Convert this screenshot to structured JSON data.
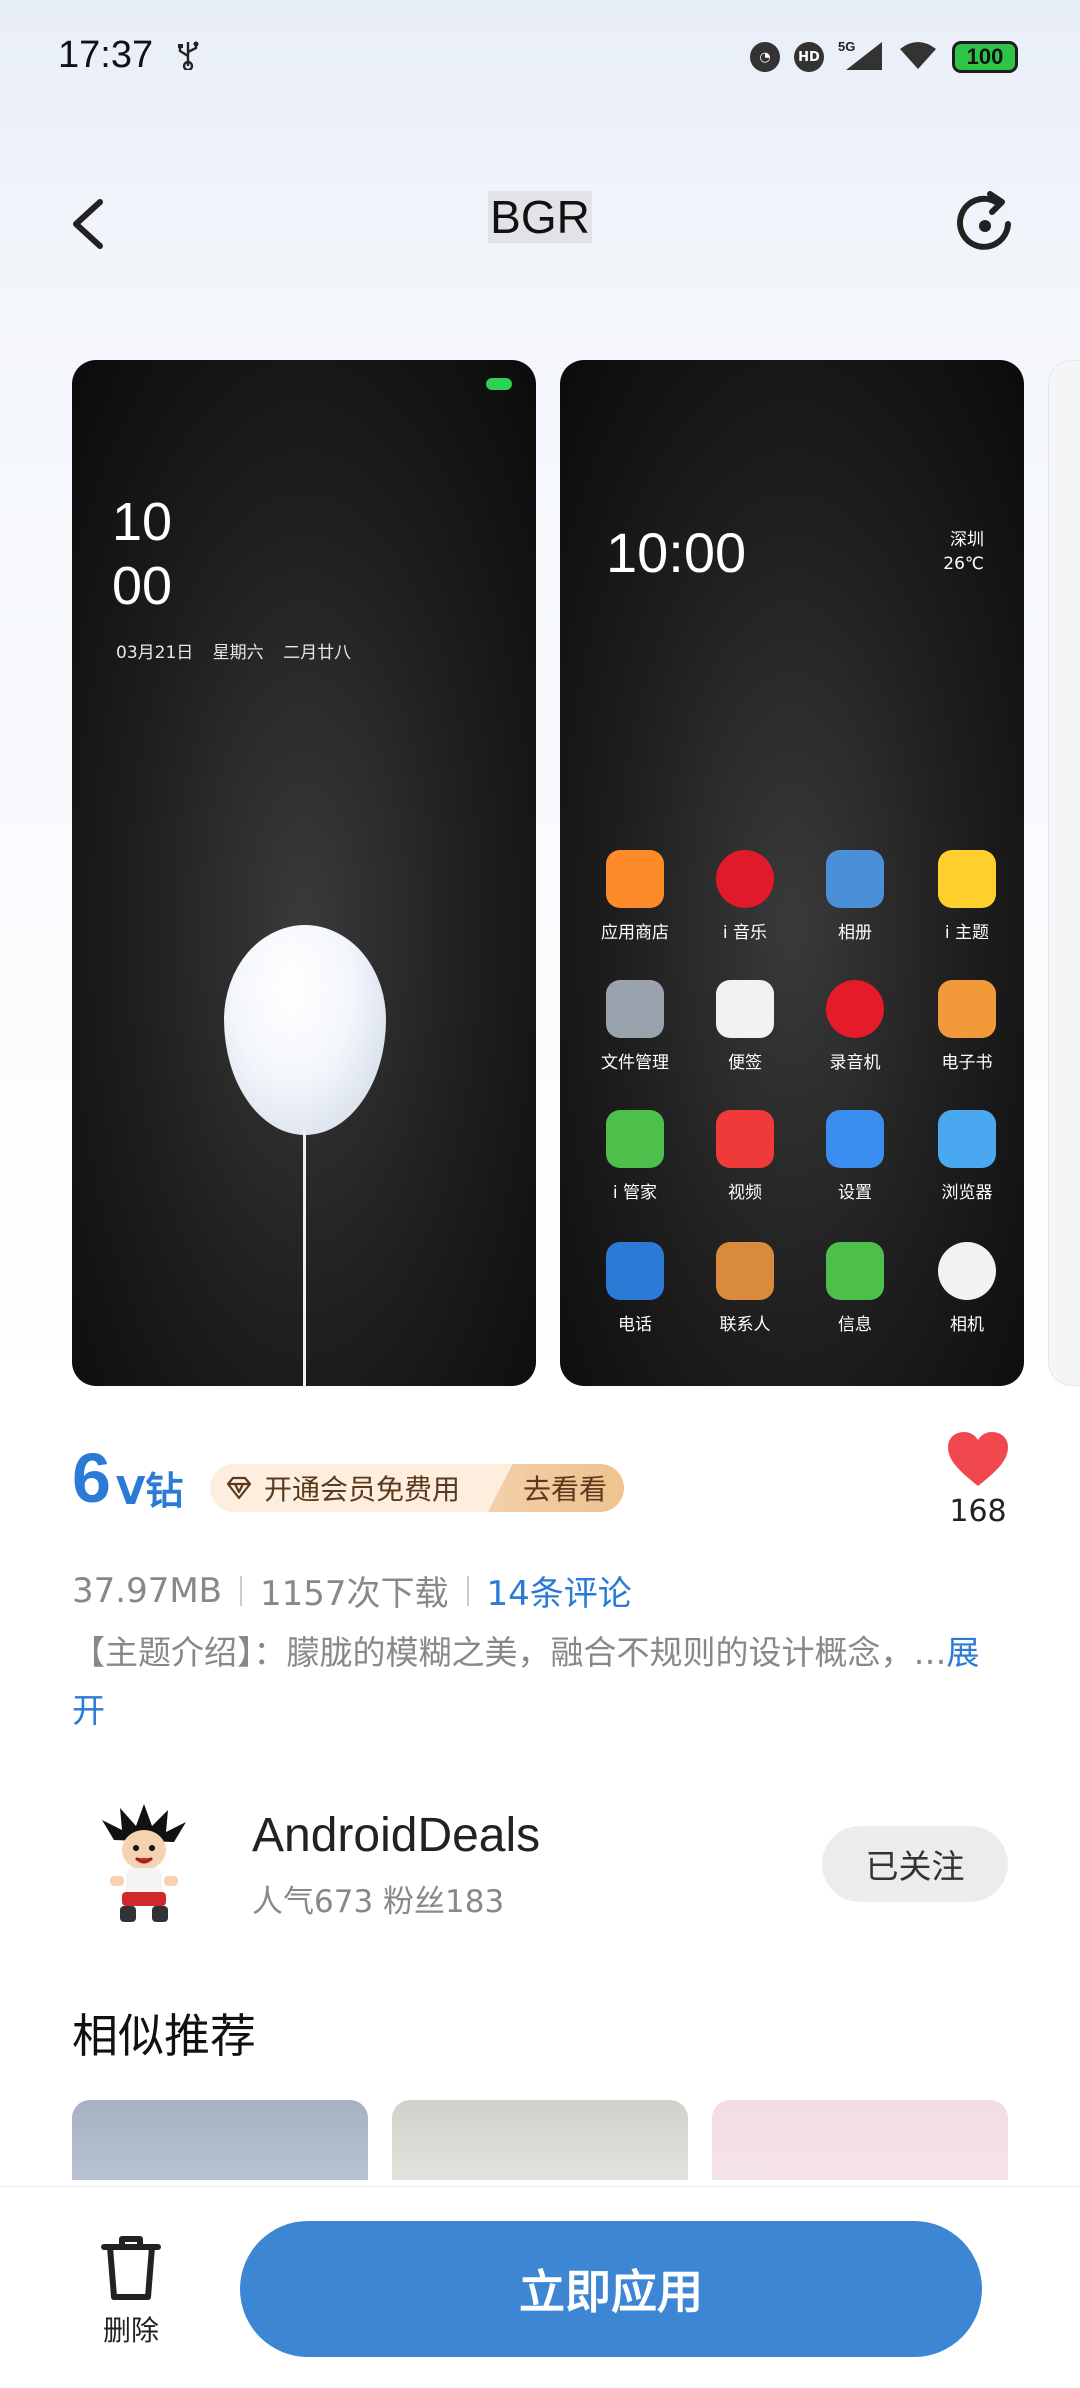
{
  "status_bar": {
    "time": "17:37",
    "icons": [
      "usb-icon",
      "nfc-icon",
      "hd-icon",
      "5g-signal-icon",
      "wifi-icon"
    ],
    "network": "5G",
    "hd": "HD",
    "battery": "100",
    "battery_color": "#2ec44a"
  },
  "header": {
    "title": "BGR",
    "back_icon": "chevron-left-icon",
    "refresh_icon": "refresh-icon"
  },
  "previews": {
    "lock": {
      "time_hours": "10",
      "time_minutes": "00",
      "date": "03月21日  星期六  二月廿八"
    },
    "home": {
      "time": "10:00",
      "city": "深圳",
      "temp": "26℃",
      "apps": [
        {
          "label": "应用商店",
          "color": "#ff8a2a"
        },
        {
          "label": "i 音乐",
          "color": "#e01a2a"
        },
        {
          "label": "相册",
          "color": "#4a90d9"
        },
        {
          "label": "i 主题",
          "color": "#ffcf2e"
        },
        {
          "label": "文件管理",
          "color": "#9aa3ad"
        },
        {
          "label": "便签",
          "color": "#f2f2f2"
        },
        {
          "label": "录音机",
          "color": "#e51b2a"
        },
        {
          "label": "电子书",
          "color": "#f29a3a"
        },
        {
          "label": "i 管家",
          "color": "#4cc04a"
        },
        {
          "label": "视频",
          "color": "#f03a3a"
        },
        {
          "label": "设置",
          "color": "#3a8ef0"
        },
        {
          "label": "浏览器",
          "color": "#4aa8f0"
        },
        {
          "label": "电话",
          "color": "#2a7ad6"
        },
        {
          "label": "联系人",
          "color": "#d98a3a"
        },
        {
          "label": "信息",
          "color": "#4cc04a"
        },
        {
          "label": "相机",
          "color": "#f2f2f2"
        }
      ]
    }
  },
  "price": {
    "amount": "6",
    "unit": "V钻",
    "color": "#2a7ad6",
    "vip_text": "开通会员免费用",
    "vip_action": "去看看"
  },
  "likes": "168",
  "meta": {
    "size": "37.97MB",
    "downloads": "1157次下载",
    "comments": "14条评论"
  },
  "description": {
    "text": "【主题介绍】：朦胧的模糊之美，融合不规则的设计概念，…",
    "more_part1": "展",
    "more_part2": "开"
  },
  "author": {
    "name": "AndroidDeals",
    "stats": "人气673 粉丝183",
    "follow_label": "已关注"
  },
  "similar": {
    "title": "相似推荐"
  },
  "bottom_bar": {
    "delete_label": "删除",
    "apply_label": "立即应用",
    "accent": "#3d86d3"
  }
}
